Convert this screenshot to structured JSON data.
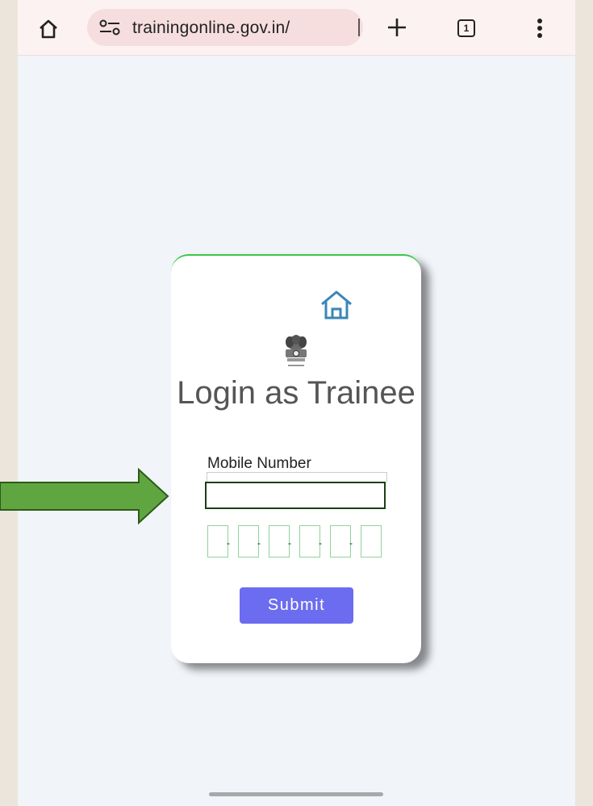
{
  "browser": {
    "url": "trainingonline.gov.in/",
    "tab_count": "1",
    "icons": [
      "home-icon",
      "site-settings-icon",
      "new-tab-icon",
      "tab-switcher-icon",
      "more-options-icon"
    ]
  },
  "card": {
    "home_icon": "home-icon",
    "emblem": "national-emblem",
    "title": "Login as Trainee",
    "mobile_label": "Mobile Number",
    "mobile_value": "",
    "otp_digits": [
      "",
      "",
      "",
      "",
      "",
      ""
    ],
    "submit_label": "Submit"
  },
  "annotation": {
    "arrow_icon": "arrow-right-icon"
  },
  "colors": {
    "accent_green": "#3cc64a",
    "arrow_green": "#5fa640",
    "submit_bg": "#6c6cf0",
    "home_icon": "#3a86b5"
  }
}
